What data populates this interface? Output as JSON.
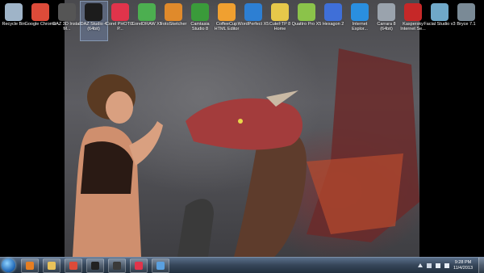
{
  "desktop_icons": [
    {
      "label": "Recycle Bin",
      "icon": "recycle-bin-icon",
      "color": "#9fb4c8"
    },
    {
      "label": "Google Chrome",
      "icon": "chrome-icon",
      "color": "#dd4b39"
    },
    {
      "label": "DAZ 3D Install M...",
      "icon": "daz-install-icon",
      "color": "#555555"
    },
    {
      "label": "DAZ Studio 4 (64bit)",
      "icon": "daz-studio-icon",
      "color": "#1c1c1c"
    },
    {
      "label": "Corel PHOTO-P...",
      "icon": "corel-photopaint-icon",
      "color": "#e0344b"
    },
    {
      "label": "CorelDRAW X5",
      "icon": "coreldraw-icon",
      "color": "#4caf50"
    },
    {
      "label": "FotoSketcher",
      "icon": "fotosketcher-icon",
      "color": "#e08a2b"
    },
    {
      "label": "Camtasia Studio 8",
      "icon": "camtasia-icon",
      "color": "#3a9b3a"
    },
    {
      "label": "CoffeeCup HTML Editor",
      "icon": "coffeecup-icon",
      "color": "#f0a030"
    },
    {
      "label": "WordPerfect X5",
      "icon": "wordperfect-icon",
      "color": "#2d7fd3"
    },
    {
      "label": "CuteFTP 8 Home",
      "icon": "cuteftp-icon",
      "color": "#e6c84a"
    },
    {
      "label": "Quattro Pro X5",
      "icon": "quattro-pro-icon",
      "color": "#8bc34a"
    },
    {
      "label": "Hexagon 2",
      "icon": "hexagon-icon",
      "color": "#3f6fd8"
    },
    {
      "label": "Internet Explor...",
      "icon": "internet-explorer-icon",
      "color": "#2a8fe0"
    },
    {
      "label": "Carrara 8 (64bit)",
      "icon": "carrara-icon",
      "color": "#9aa3ad"
    },
    {
      "label": "Kaspersky Internet Se...",
      "icon": "kaspersky-icon",
      "color": "#c62828"
    },
    {
      "label": "Facial Studio v3",
      "icon": "facial-studio-icon",
      "color": "#6fa8c8"
    },
    {
      "label": "Bryce 7.1",
      "icon": "bryce-icon",
      "color": "#7a8a96"
    }
  ],
  "taskbar": {
    "pinned": [
      {
        "icon": "media-player-icon",
        "color": "#e67e22"
      },
      {
        "icon": "file-explorer-icon",
        "color": "#e8c25a"
      },
      {
        "icon": "chrome-icon",
        "color": "#dd4b39"
      },
      {
        "icon": "daz-studio-icon",
        "color": "#222222"
      },
      {
        "icon": "camtasia-icon",
        "color": "#3a3a3a"
      },
      {
        "icon": "corel-photopaint-icon",
        "color": "#e0344b"
      },
      {
        "icon": "network-icon",
        "color": "#5aa0e0"
      }
    ],
    "time": "9:28 PM",
    "date": "11/4/2013"
  }
}
